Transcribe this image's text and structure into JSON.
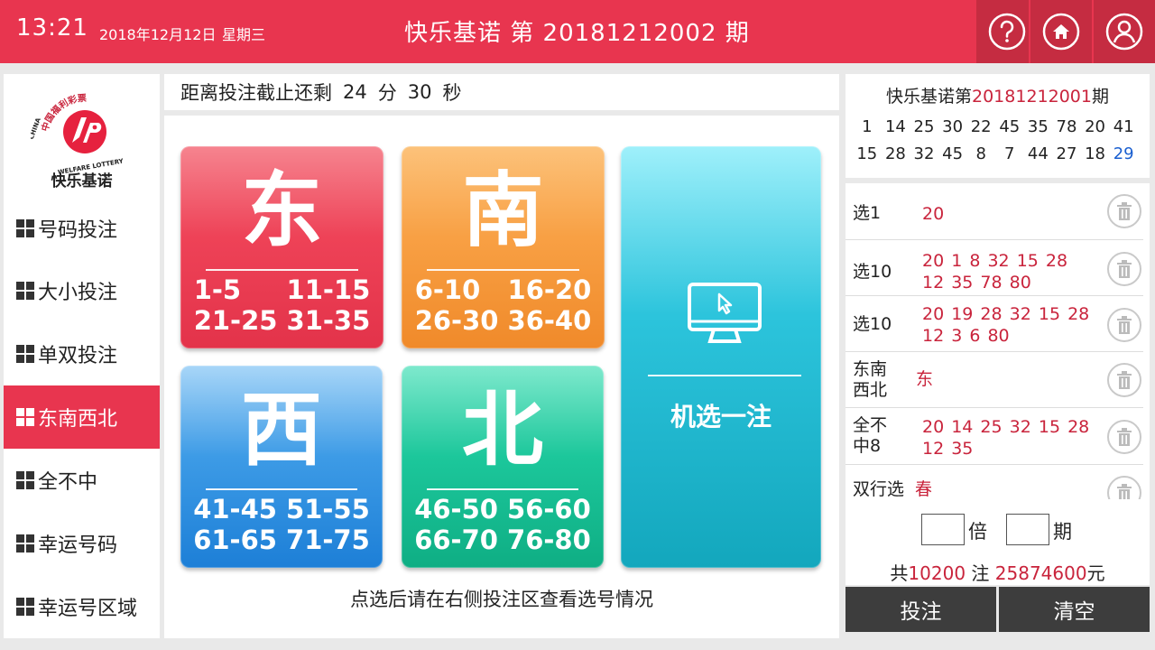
{
  "header": {
    "time": "13:21",
    "date": "2018年12月12日",
    "weekday": "星期三",
    "title": "快乐基诺 第 20181212002 期",
    "buttons": [
      {
        "name": "help",
        "icon": "help-icon"
      },
      {
        "name": "home",
        "icon": "home-icon"
      },
      {
        "name": "user",
        "icon": "user-icon"
      }
    ]
  },
  "sidebar": {
    "logo_text": "快乐基诺",
    "logo_ring_text": "中国福利彩票 CHINA WELFARE LOTTERY",
    "items": [
      {
        "label": "号码投注",
        "active": false
      },
      {
        "label": "大小投注",
        "active": false
      },
      {
        "label": "单双投注",
        "active": false
      },
      {
        "label": "东南西北",
        "active": true
      },
      {
        "label": "全不中",
        "active": false
      },
      {
        "label": "幸运号码",
        "active": false
      },
      {
        "label": "幸运号区域",
        "active": false
      }
    ]
  },
  "countdown": {
    "prefix": "距离投注截止还剩",
    "minutes": "24",
    "min_unit": "分",
    "seconds": "30",
    "sec_unit": "秒"
  },
  "tiles": {
    "east": {
      "label": "东",
      "row1": "1-5     11-15",
      "row2": "21-25 31-35",
      "color": "#e8354f"
    },
    "south": {
      "label": "南",
      "row1": "6-10   16-20",
      "row2": "26-30 36-40",
      "color": "#f79a3c"
    },
    "west": {
      "label": "西",
      "row1": "41-45 51-55",
      "row2": "61-65 71-75",
      "color": "#2a8ee0"
    },
    "north": {
      "label": "北",
      "row1": "46-50 56-60",
      "row2": "66-70 76-80",
      "color": "#14bb8f"
    },
    "random": {
      "label": "机选一注",
      "icon": "monitor-cursor-icon",
      "color": "#1fb4cb"
    }
  },
  "hint": "点选后请在右侧投注区查看选号情况",
  "last_draw": {
    "prefix": "快乐基诺第",
    "period": "20181212001",
    "suffix": "期",
    "row1": [
      "1",
      "14",
      "25",
      "30",
      "22",
      "45",
      "35",
      "78",
      "20",
      "41"
    ],
    "row2": [
      "15",
      "28",
      "32",
      "45",
      "8",
      "7",
      "44",
      "27",
      "18",
      "29"
    ]
  },
  "selections": [
    {
      "label": "选1",
      "numbers": "20"
    },
    {
      "label": "选10",
      "numbers": "20 1 8 32 15 28 12 35 78 80"
    },
    {
      "label": "选10",
      "numbers": "20 19 28 32 15 28 12 3 6 80"
    },
    {
      "label": "东南西北",
      "numbers": "东"
    },
    {
      "label": "全不中8",
      "numbers": "20 14 25 32 15 28 12 35"
    },
    {
      "label": "双行选",
      "numbers": "春"
    }
  ],
  "multiplier": {
    "times_unit": "倍",
    "periods_unit": "期",
    "times_value": "",
    "periods_value": ""
  },
  "total": {
    "prefix": "共",
    "count": "10200",
    "count_unit": "注",
    "amount": "25874600",
    "amount_unit": "元"
  },
  "actions": {
    "bet": "投注",
    "clear": "清空"
  }
}
